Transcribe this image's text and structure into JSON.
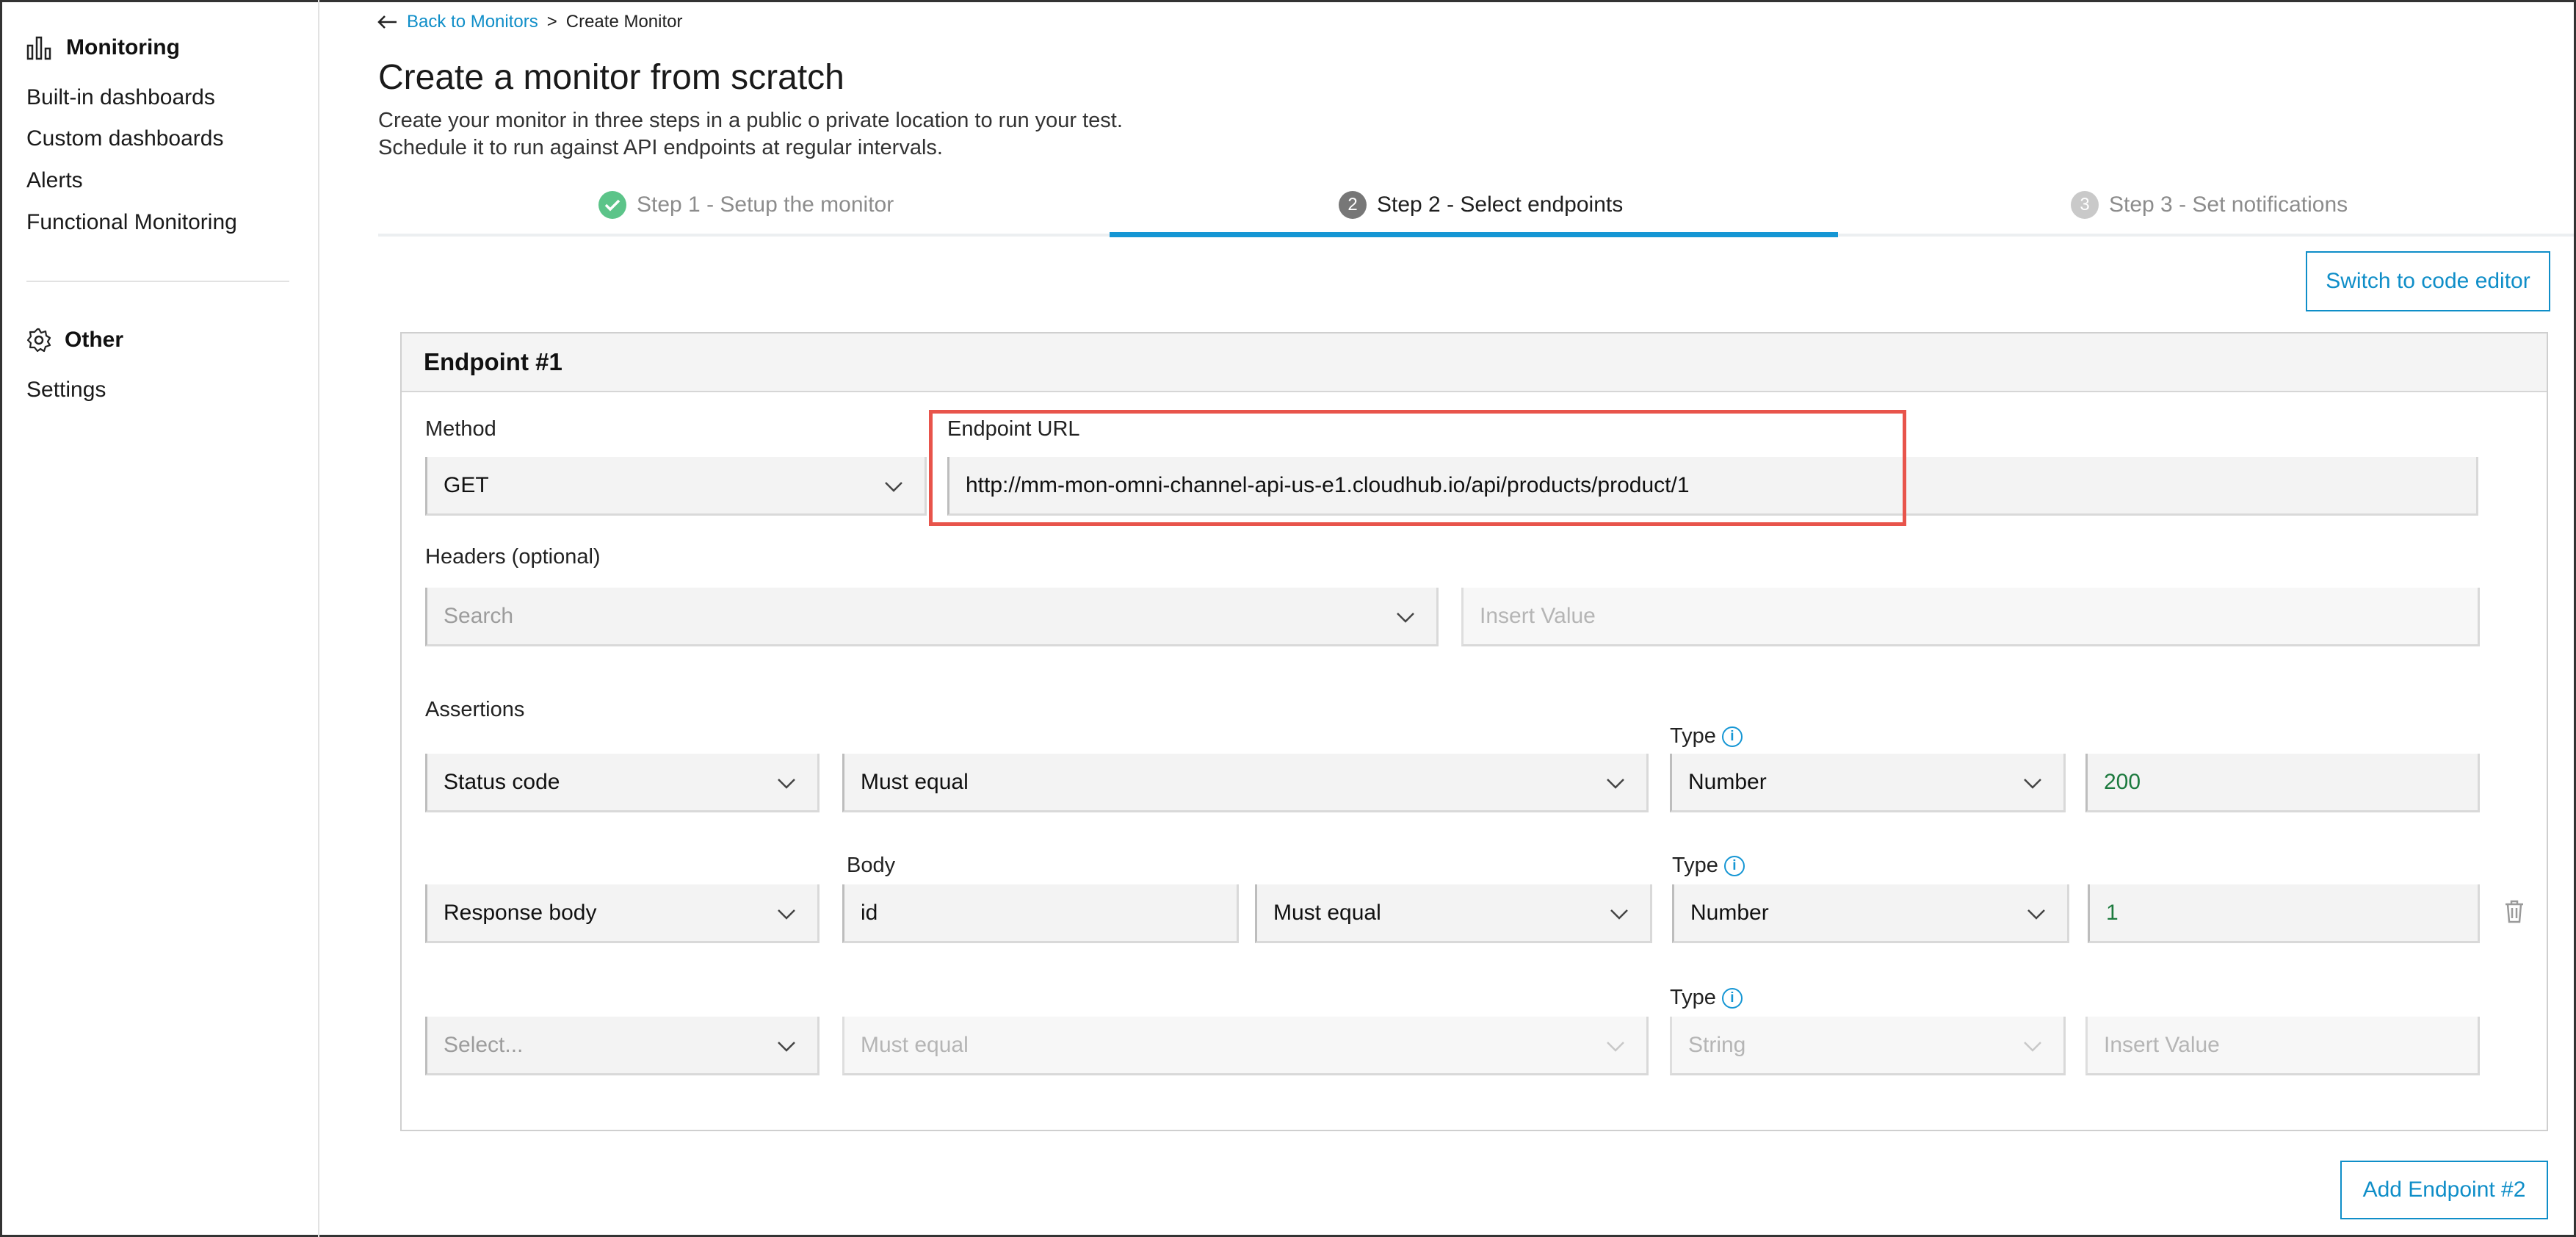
{
  "sidebar": {
    "monitoring_heading": "Monitoring",
    "items": [
      "Built-in dashboards",
      "Custom dashboards",
      "Alerts",
      "Functional Monitoring"
    ],
    "other_heading": "Other",
    "other_items": [
      "Settings"
    ]
  },
  "breadcrumb": {
    "back_label": "Back to Monitors",
    "separator": ">",
    "current": "Create Monitor"
  },
  "page": {
    "title": "Create a monitor from scratch",
    "subtitle_line1": "Create your monitor in three steps in a public o private location to run your test.",
    "subtitle_line2": "Schedule it to run against API endpoints at regular intervals."
  },
  "steps": [
    {
      "number": "",
      "label": "Step 1 - Setup the monitor",
      "state": "done"
    },
    {
      "number": "2",
      "label": "Step 2 - Select endpoints",
      "state": "active"
    },
    {
      "number": "3",
      "label": "Step 3 - Set notifications",
      "state": "pending"
    }
  ],
  "buttons": {
    "code_editor": "Switch to code editor",
    "add_endpoint": "Add Endpoint #2"
  },
  "endpoint": {
    "title": "Endpoint #1",
    "method_label": "Method",
    "method_value": "GET",
    "url_label": "Endpoint URL",
    "url_value": "http://mm-mon-omni-channel-api-us-e1.cloudhub.io/api/products/product/1",
    "headers_label": "Headers (optional)",
    "headers_search_placeholder": "Search",
    "headers_value_placeholder": "Insert Value",
    "assertions_label": "Assertions",
    "type_label": "Type",
    "body_label": "Body",
    "rows": [
      {
        "source": "Status code",
        "comparator": "Must equal",
        "type": "Number",
        "value": "200"
      },
      {
        "source": "Response body",
        "body": "id",
        "comparator": "Must equal",
        "type": "Number",
        "value": "1"
      },
      {
        "source": "Select...",
        "comparator": "Must equal",
        "type": "String",
        "value": "Insert Value"
      }
    ]
  },
  "colors": {
    "accent": "#1596d4",
    "success": "#5cc489",
    "highlight": "#e8544b"
  }
}
